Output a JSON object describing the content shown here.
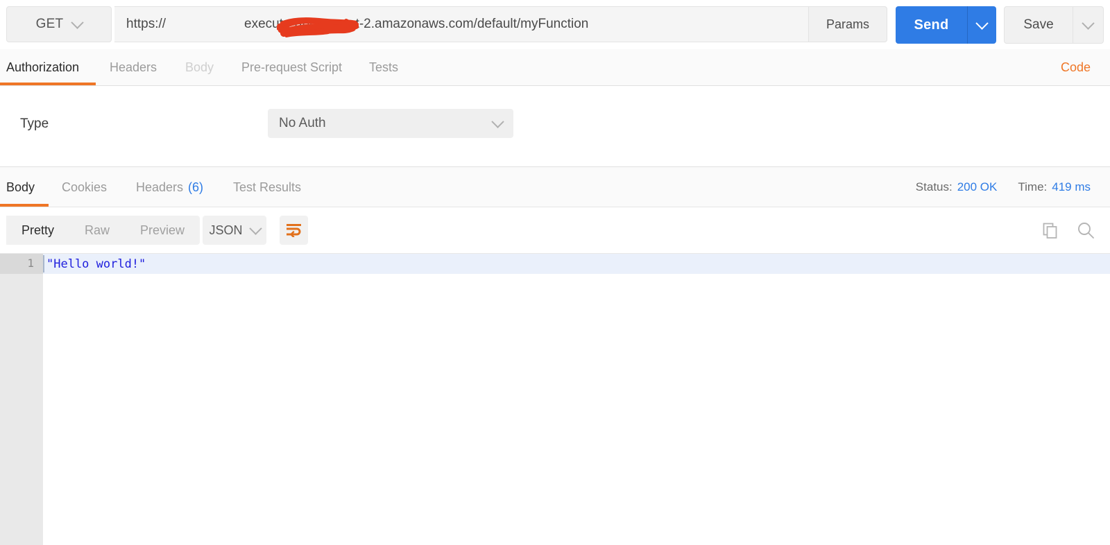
{
  "request": {
    "method": "GET",
    "url_prefix": "https://",
    "url_suffix": "execute-api.us-east-2.amazonaws.com/default/myFunction",
    "url_full": "https://execute-api.us-east-2.amazonaws.com/default/myFunction",
    "params_label": "Params",
    "send_label": "Send",
    "save_label": "Save",
    "redaction_color": "#e63b1e",
    "send_color": "#2f7ce5"
  },
  "request_tabs": [
    {
      "label": "Authorization",
      "state": "active"
    },
    {
      "label": "Headers",
      "state": "inactive"
    },
    {
      "label": "Body",
      "state": "disabled"
    },
    {
      "label": "Pre-request Script",
      "state": "inactive"
    },
    {
      "label": "Tests",
      "state": "inactive"
    }
  ],
  "code_link": "Code",
  "authorization": {
    "type_label": "Type",
    "type_value": "No Auth"
  },
  "response_tabs": [
    {
      "label": "Body",
      "state": "active",
      "count": ""
    },
    {
      "label": "Cookies",
      "state": "inactive",
      "count": ""
    },
    {
      "label": "Headers",
      "state": "inactive",
      "count": "(6)"
    },
    {
      "label": "Test Results",
      "state": "inactive",
      "count": ""
    }
  ],
  "response_meta": {
    "status_label": "Status:",
    "status_value": "200 OK",
    "time_label": "Time:",
    "time_value": "419 ms",
    "accent": "#2f7ce5"
  },
  "body_toolbar": {
    "views": [
      {
        "label": "Pretty",
        "state": "active"
      },
      {
        "label": "Raw",
        "state": "inactive"
      },
      {
        "label": "Preview",
        "state": "inactive"
      }
    ],
    "format": "JSON",
    "wrap_icon": "word-wrap-icon",
    "copy_icon": "copy-icon",
    "search_icon": "search-icon",
    "accent": "#ef7626"
  },
  "response_body": {
    "lines": [
      {
        "number": "1",
        "text": "\"Hello world!\""
      }
    ],
    "text_color": "#2020dd",
    "highlight_color": "#eaf0fb"
  }
}
